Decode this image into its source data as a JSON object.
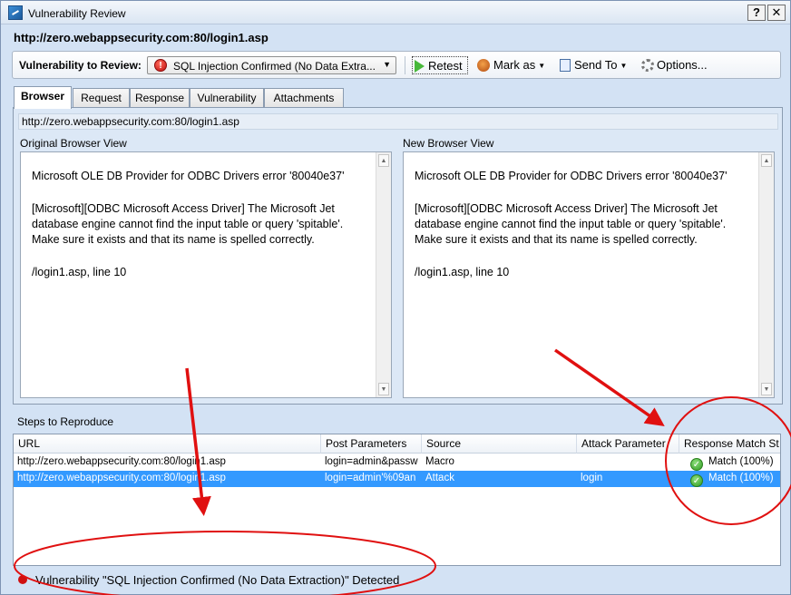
{
  "window": {
    "title": "Vulnerability Review",
    "help_button": "?",
    "close_button": "✕"
  },
  "url_line": "http://zero.webappsecurity.com:80/login1.asp",
  "toolbar": {
    "label": "Vulnerability to Review:",
    "selected_vulnerability": "SQL Injection Confirmed (No Data Extra...",
    "retest": "Retest",
    "mark_as": "Mark as",
    "send_to": "Send To",
    "options": "Options..."
  },
  "tabs": [
    "Browser",
    "Request",
    "Response",
    "Vulnerability",
    "Attachments"
  ],
  "browser": {
    "address": "http://zero.webappsecurity.com:80/login1.asp",
    "original_label": "Original Browser View",
    "new_label": "New Browser View",
    "original_lines": [
      "Microsoft OLE DB Provider for ODBC Drivers error '80040e37'",
      "[Microsoft][ODBC Microsoft Access Driver] The Microsoft Jet database engine cannot find the input table or query 'spitable'. Make sure it exists and that its name is spelled correctly.",
      "/login1.asp, line 10"
    ],
    "new_lines": [
      "Microsoft OLE DB Provider for ODBC Drivers error '80040e37'",
      "[Microsoft][ODBC Microsoft Access Driver] The Microsoft Jet database engine cannot find the input table or query 'spitable'. Make sure it exists and that its name is spelled correctly.",
      "/login1.asp, line 10"
    ]
  },
  "steps": {
    "label": "Steps to Reproduce",
    "columns": [
      "URL",
      "Post Parameters",
      "Source",
      "Attack Parameter",
      "Response Match St"
    ],
    "rows": [
      {
        "url": "http://zero.webappsecurity.com:80/login1.asp",
        "post": "login=admin&passw",
        "source": "Macro",
        "attack": "",
        "match": "Match  (100%)"
      },
      {
        "url": "http://zero.webappsecurity.com:80/login1.asp",
        "post": "login=admin'%09an",
        "source": "Attack",
        "attack": "login",
        "match": "Match  (100%)"
      }
    ]
  },
  "status_text": "Vulnerability \"SQL Injection Confirmed (No Data Extraction)\" Detected",
  "colors": {
    "selection": "#3399ff",
    "annotation": "#e01010"
  }
}
